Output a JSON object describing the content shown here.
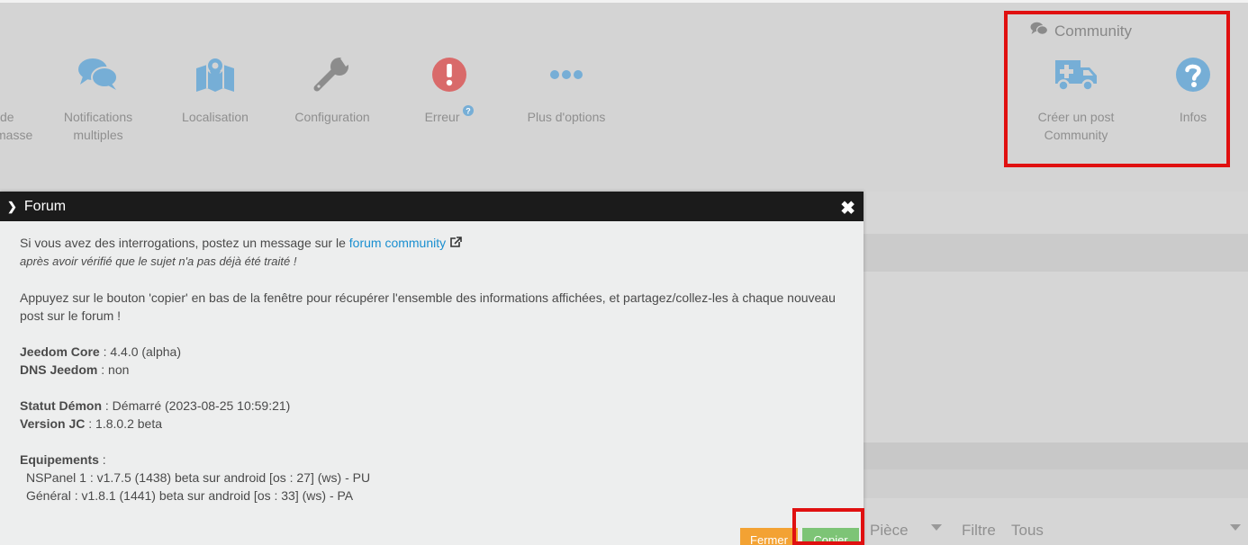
{
  "toolbar": {
    "items": [
      {
        "label_line1": "de",
        "label_line2": "masse",
        "icon": "partial-hidden"
      },
      {
        "label_line1": "Notifications",
        "label_line2": "multiples",
        "icon": "comments-icon"
      },
      {
        "label_line1": "Localisation",
        "label_line2": "",
        "icon": "map-marker-icon"
      },
      {
        "label_line1": "Configuration",
        "label_line2": "",
        "icon": "wrench-icon"
      },
      {
        "label_line1": "Erreur",
        "label_line2": "",
        "icon": "exclamation-circle-icon"
      },
      {
        "label_line1": "Plus d'options",
        "label_line2": "",
        "icon": "ellipsis-icon"
      }
    ],
    "community": {
      "title": "Community",
      "items": [
        {
          "label_line1": "Créer un post",
          "label_line2": "Community",
          "icon": "ambulance-icon"
        },
        {
          "label_line1": "Infos",
          "label_line2": "",
          "icon": "question-circle-icon"
        }
      ]
    }
  },
  "modal": {
    "title": "Forum",
    "intro": "Si vous avez des interrogations, postez un message sur le",
    "link_text": "forum community",
    "intro_note": "après avoir vérifié que le sujet n'a pas déjà été traité !",
    "instructions_line1": "Appuyez sur le bouton 'copier' en bas de la fenêtre pour récupérer l'ensemble des informations affichées, et partagez/collez-les à chaque nouveau",
    "instructions_line2": "post sur le forum !",
    "jeedom_core_label": "Jeedom Core",
    "jeedom_core_value": " : 4.4.0 (alpha)",
    "dns_label": "DNS Jeedom",
    "dns_value": " : non",
    "daemon_label": "Statut Démon",
    "daemon_value": " : Démarré (2023-08-25 10:59:21)",
    "version_label": "Version JC",
    "version_value": " : 1.8.0.2 beta",
    "equipment_label": "Equipements",
    "equipment_sep": " :",
    "equipment": [
      "NSPanel 1 : v1.7.5 (1438) beta sur android [os : 27] (ws) - PU",
      "Général : v1.8.1 (1441) beta sur android [os : 33] (ws) - PA"
    ],
    "buttons": {
      "close": "Fermer",
      "copy": "Copier"
    }
  },
  "filters": {
    "piece_label": "Pièce",
    "filtre_label": "Filtre",
    "filtre_value": "Tous"
  }
}
